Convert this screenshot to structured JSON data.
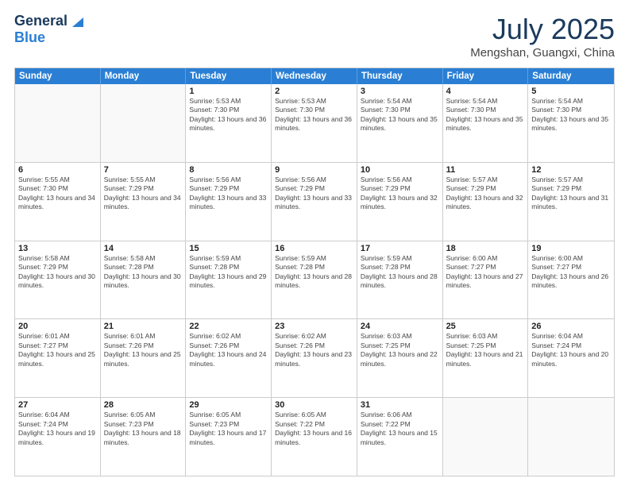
{
  "header": {
    "logo_line1": "General",
    "logo_line2": "Blue",
    "title": "July 2025",
    "subtitle": "Mengshan, Guangxi, China"
  },
  "calendar": {
    "days_of_week": [
      "Sunday",
      "Monday",
      "Tuesday",
      "Wednesday",
      "Thursday",
      "Friday",
      "Saturday"
    ],
    "rows": [
      [
        {
          "day": "",
          "info": ""
        },
        {
          "day": "",
          "info": ""
        },
        {
          "day": "1",
          "info": "Sunrise: 5:53 AM\nSunset: 7:30 PM\nDaylight: 13 hours and 36 minutes."
        },
        {
          "day": "2",
          "info": "Sunrise: 5:53 AM\nSunset: 7:30 PM\nDaylight: 13 hours and 36 minutes."
        },
        {
          "day": "3",
          "info": "Sunrise: 5:54 AM\nSunset: 7:30 PM\nDaylight: 13 hours and 35 minutes."
        },
        {
          "day": "4",
          "info": "Sunrise: 5:54 AM\nSunset: 7:30 PM\nDaylight: 13 hours and 35 minutes."
        },
        {
          "day": "5",
          "info": "Sunrise: 5:54 AM\nSunset: 7:30 PM\nDaylight: 13 hours and 35 minutes."
        }
      ],
      [
        {
          "day": "6",
          "info": "Sunrise: 5:55 AM\nSunset: 7:30 PM\nDaylight: 13 hours and 34 minutes."
        },
        {
          "day": "7",
          "info": "Sunrise: 5:55 AM\nSunset: 7:29 PM\nDaylight: 13 hours and 34 minutes."
        },
        {
          "day": "8",
          "info": "Sunrise: 5:56 AM\nSunset: 7:29 PM\nDaylight: 13 hours and 33 minutes."
        },
        {
          "day": "9",
          "info": "Sunrise: 5:56 AM\nSunset: 7:29 PM\nDaylight: 13 hours and 33 minutes."
        },
        {
          "day": "10",
          "info": "Sunrise: 5:56 AM\nSunset: 7:29 PM\nDaylight: 13 hours and 32 minutes."
        },
        {
          "day": "11",
          "info": "Sunrise: 5:57 AM\nSunset: 7:29 PM\nDaylight: 13 hours and 32 minutes."
        },
        {
          "day": "12",
          "info": "Sunrise: 5:57 AM\nSunset: 7:29 PM\nDaylight: 13 hours and 31 minutes."
        }
      ],
      [
        {
          "day": "13",
          "info": "Sunrise: 5:58 AM\nSunset: 7:29 PM\nDaylight: 13 hours and 30 minutes."
        },
        {
          "day": "14",
          "info": "Sunrise: 5:58 AM\nSunset: 7:28 PM\nDaylight: 13 hours and 30 minutes."
        },
        {
          "day": "15",
          "info": "Sunrise: 5:59 AM\nSunset: 7:28 PM\nDaylight: 13 hours and 29 minutes."
        },
        {
          "day": "16",
          "info": "Sunrise: 5:59 AM\nSunset: 7:28 PM\nDaylight: 13 hours and 28 minutes."
        },
        {
          "day": "17",
          "info": "Sunrise: 5:59 AM\nSunset: 7:28 PM\nDaylight: 13 hours and 28 minutes."
        },
        {
          "day": "18",
          "info": "Sunrise: 6:00 AM\nSunset: 7:27 PM\nDaylight: 13 hours and 27 minutes."
        },
        {
          "day": "19",
          "info": "Sunrise: 6:00 AM\nSunset: 7:27 PM\nDaylight: 13 hours and 26 minutes."
        }
      ],
      [
        {
          "day": "20",
          "info": "Sunrise: 6:01 AM\nSunset: 7:27 PM\nDaylight: 13 hours and 25 minutes."
        },
        {
          "day": "21",
          "info": "Sunrise: 6:01 AM\nSunset: 7:26 PM\nDaylight: 13 hours and 25 minutes."
        },
        {
          "day": "22",
          "info": "Sunrise: 6:02 AM\nSunset: 7:26 PM\nDaylight: 13 hours and 24 minutes."
        },
        {
          "day": "23",
          "info": "Sunrise: 6:02 AM\nSunset: 7:26 PM\nDaylight: 13 hours and 23 minutes."
        },
        {
          "day": "24",
          "info": "Sunrise: 6:03 AM\nSunset: 7:25 PM\nDaylight: 13 hours and 22 minutes."
        },
        {
          "day": "25",
          "info": "Sunrise: 6:03 AM\nSunset: 7:25 PM\nDaylight: 13 hours and 21 minutes."
        },
        {
          "day": "26",
          "info": "Sunrise: 6:04 AM\nSunset: 7:24 PM\nDaylight: 13 hours and 20 minutes."
        }
      ],
      [
        {
          "day": "27",
          "info": "Sunrise: 6:04 AM\nSunset: 7:24 PM\nDaylight: 13 hours and 19 minutes."
        },
        {
          "day": "28",
          "info": "Sunrise: 6:05 AM\nSunset: 7:23 PM\nDaylight: 13 hours and 18 minutes."
        },
        {
          "day": "29",
          "info": "Sunrise: 6:05 AM\nSunset: 7:23 PM\nDaylight: 13 hours and 17 minutes."
        },
        {
          "day": "30",
          "info": "Sunrise: 6:05 AM\nSunset: 7:22 PM\nDaylight: 13 hours and 16 minutes."
        },
        {
          "day": "31",
          "info": "Sunrise: 6:06 AM\nSunset: 7:22 PM\nDaylight: 13 hours and 15 minutes."
        },
        {
          "day": "",
          "info": ""
        },
        {
          "day": "",
          "info": ""
        }
      ]
    ]
  }
}
